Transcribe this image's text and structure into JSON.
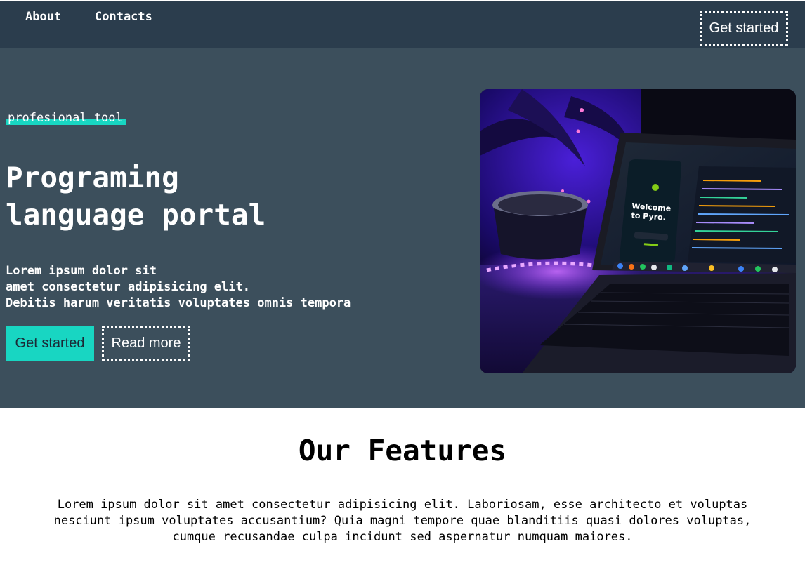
{
  "nav": {
    "links": [
      "About",
      "Contacts"
    ],
    "cta_label": "Get started"
  },
  "hero": {
    "tag": "profesional tool",
    "title_line1": "Programing",
    "title_line2": "language portal",
    "description_lines": [
      "Lorem ipsum dolor sit",
      "amet consectetur adipisicing elit.",
      "Debitis harum veritatis voluptates omnis tempora"
    ],
    "primary_button": "Get started",
    "secondary_button": "Read more",
    "image_screen_title": "Welcome to Pyro."
  },
  "features": {
    "title": "Our Features",
    "text_lines": [
      "Lorem ipsum dolor sit amet consectetur adipisicing elit. Laboriosam, esse architecto et voluptas",
      "nesciunt ipsum voluptates accusantium? Quia magni tempore quae blanditiis quasi dolores voluptas,",
      "cumque recusandae culpa incidunt sed aspernatur numquam maiores."
    ]
  },
  "colors": {
    "nav_bg": "#2b3d4d",
    "hero_bg": "#3c4f5c",
    "accent": "#18d6c2"
  }
}
